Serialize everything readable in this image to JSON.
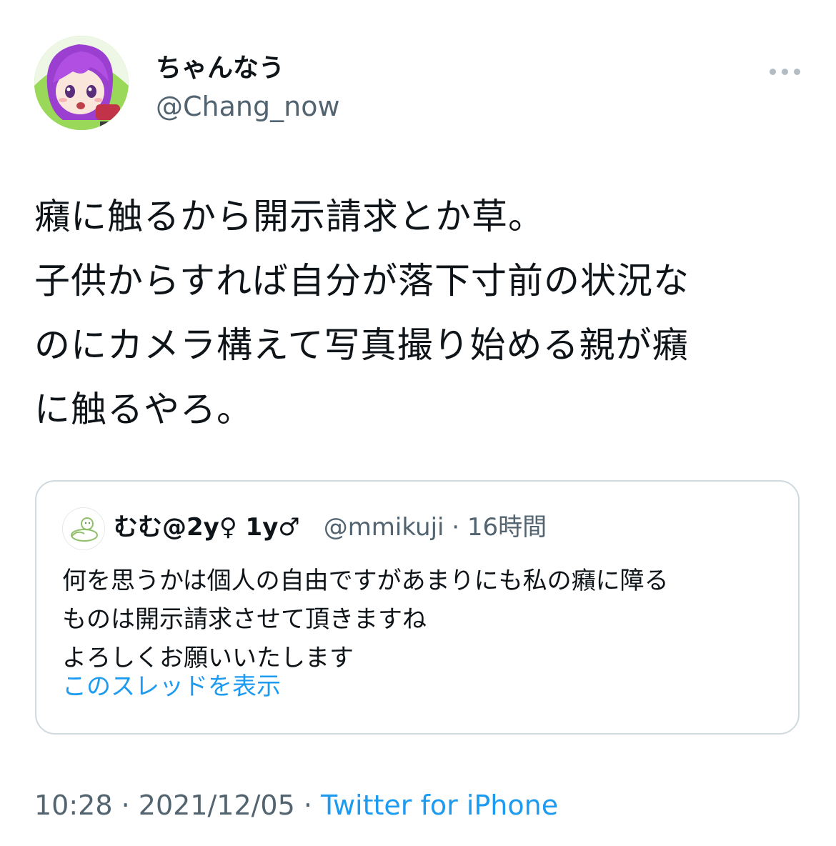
{
  "user": {
    "display_name": "ちゃんなう",
    "handle": "@Chang_now"
  },
  "tweet": {
    "lines": [
      "癪に触るから開示請求とか草。",
      "子供からすれば自分が落下寸前の状況な",
      "のにカメラ構えて写真撮り始める親が癪",
      "に触るやろ。"
    ]
  },
  "quote": {
    "display_name": "むむ@2y♀ 1y♂",
    "handle": "@mmikuji",
    "separator": " · ",
    "time": "16時間",
    "lines": [
      "何を思うかは個人の自由ですがあまりにも私の癪に障る",
      "ものは開示請求させて頂きますね",
      "よろしくお願いいたします"
    ],
    "show_thread": "このスレッドを表示"
  },
  "footer": {
    "time": "10:28",
    "sep1": " · ",
    "date": "2021/12/05",
    "sep2": " · ",
    "source": "Twitter for iPhone"
  },
  "icons": {
    "more": "more-horizontal-icon"
  },
  "colors": {
    "text": "#0f1419",
    "secondary": "#536471",
    "link": "#1d9bf0",
    "border": "#cfd9de"
  }
}
